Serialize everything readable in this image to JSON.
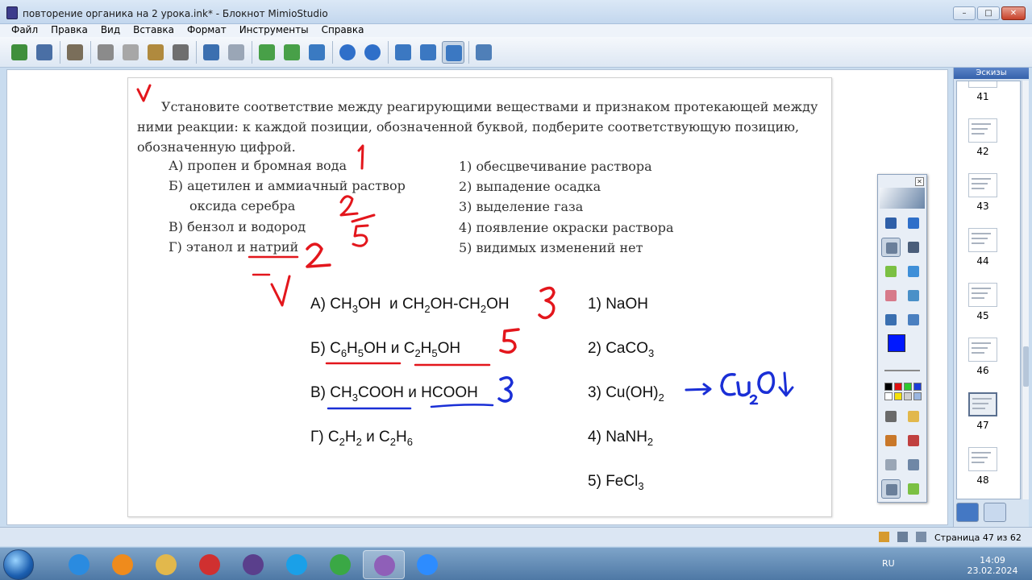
{
  "window": {
    "title": "повторение органика на 2 урока.ink* - Блокнот MimioStudio",
    "controls": [
      "–",
      "□",
      "✕"
    ]
  },
  "menu": [
    "Файл",
    "Правка",
    "Вид",
    "Вставка",
    "Формат",
    "Инструменты",
    "Справка"
  ],
  "toolbar_icons": [
    {
      "name": "open-icon",
      "color": "#3f8f3c"
    },
    {
      "name": "save-icon",
      "color": "#4a6fa5"
    },
    {
      "name": "print-icon",
      "color": "#7a6e5a"
    },
    {
      "name": "cut-icon",
      "color": "#8b8b8b"
    },
    {
      "name": "copy-icon",
      "color": "#a7a7a7"
    },
    {
      "name": "paste-icon",
      "color": "#b08a3e"
    },
    {
      "name": "delete-icon",
      "color": "#6f6f6f"
    },
    {
      "name": "undo-icon",
      "color": "#3b6fb0"
    },
    {
      "name": "redo-icon",
      "color": "#9aa6b6"
    },
    {
      "name": "new-page-icon",
      "color": "#48a048"
    },
    {
      "name": "duplicate-page-icon",
      "color": "#48a048"
    },
    {
      "name": "users-icon",
      "color": "#3a7ac2"
    },
    {
      "name": "previous-page-icon",
      "color": "#2f6fc9"
    },
    {
      "name": "next-page-icon",
      "color": "#2f6fc9"
    },
    {
      "name": "zoom-in-icon",
      "color": "#3b78c2"
    },
    {
      "name": "zoom-out-icon",
      "color": "#3b78c2"
    },
    {
      "name": "zoom-fit-icon",
      "color": "#3b78c2"
    },
    {
      "name": "screen-icon",
      "color": "#4f7fb8"
    }
  ],
  "page": {
    "task": "Установите соответствие между реагирующими веществами и признаком протекающей между ними реакции: к каждой позиции, обозначенной буквой, подберите соответствующую позицию, обозначенную цифрой.",
    "letter_options": [
      "А) пропен и бромная вода",
      "Б) ацетилен и аммиачный раствор",
      "оксида серебра",
      "В) бензол и водород",
      "Г) этанол и натрий"
    ],
    "number_options": [
      "1) обесцвечивание раствора",
      "2) выпадение осадка",
      "3) выделение газа",
      "4) появление окраски раствора",
      "5) видимых изменений нет"
    ],
    "task2": {
      "left": [
        {
          "label": "А)",
          "a": "CH",
          "a_sub": "3",
          "a_rest": "OH",
          "and": "и",
          "b": "CH",
          "b_sub": "2",
          "b_mid": "OH-CH",
          "b_sub2": "2",
          "b_rest": "OH"
        },
        {
          "label": "Б)",
          "a": "C",
          "a_sub": "6",
          "a_mid": "H",
          "a_sub2": "5",
          "a_rest": "OH",
          "and": "и",
          "b": "C",
          "b_sub": "2",
          "b_mid": "H",
          "b_sub2": "5",
          "b_rest": "OH"
        },
        {
          "label": "В)",
          "a": "CH",
          "a_sub": "3",
          "a_rest": "COOH",
          "and": "и",
          "b": "HCOOH"
        },
        {
          "label": "Г)",
          "a": "C",
          "a_sub": "2",
          "a_mid": "H",
          "a_sub2": "2",
          "and": "и",
          "b": "C",
          "b_sub": "2",
          "b_mid": "H",
          "b_sub2": "6"
        }
      ],
      "right": [
        {
          "label": "1)",
          "text": "NaOH",
          "sub": "",
          "rest": ""
        },
        {
          "label": "2)",
          "text": "CaCO",
          "sub": "3",
          "rest": ""
        },
        {
          "label": "3)",
          "text": "Cu(OH)",
          "sub": "2",
          "rest": ""
        },
        {
          "label": "4)",
          "text": "NaNH",
          "sub": "2",
          "rest": ""
        },
        {
          "label": "5)",
          "text": "FeCl",
          "sub": "3",
          "rest": ""
        }
      ]
    },
    "ink_colors": {
      "red": "#e3161c",
      "blue": "#1a2fd6"
    }
  },
  "thumbnails": {
    "header": "Эскизы",
    "pages": [
      "41",
      "42",
      "43",
      "44",
      "45",
      "46",
      "47",
      "48"
    ],
    "current": "47"
  },
  "tools_palette": {
    "current_color": "#0018ff",
    "swatches": [
      "#000000",
      "#e01010",
      "#2ec82e",
      "#1a3cd8",
      "#ffffff",
      "#f5e10a",
      "#cfcfcf",
      "#9ab6e0"
    ]
  },
  "status": {
    "page_indicator": "Страница 47 из 62"
  },
  "taskbar": {
    "language": "RU",
    "time": "14:09",
    "date": "23.02.2024",
    "apps": [
      {
        "name": "internet-explorer-icon",
        "color": "#2a8be0"
      },
      {
        "name": "media-player-icon",
        "color": "#ef8b1c"
      },
      {
        "name": "file-explorer-icon",
        "color": "#e2b84c"
      },
      {
        "name": "ccleaner-icon",
        "color": "#d03030"
      },
      {
        "name": "mimio-notebook-icon",
        "color": "#5a3f8c"
      },
      {
        "name": "skype-icon",
        "color": "#1aa0e8"
      },
      {
        "name": "chrome-icon",
        "color": "#3aa845"
      },
      {
        "name": "mimio-studio-icon",
        "color": "#8f5fb8"
      },
      {
        "name": "zoom-icon",
        "color": "#2d8cff"
      }
    ]
  }
}
